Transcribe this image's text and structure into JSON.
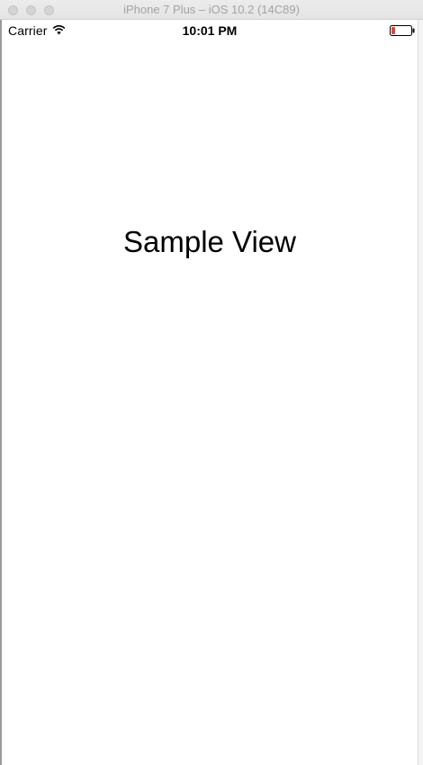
{
  "window": {
    "title": "iPhone 7 Plus – iOS 10.2 (14C89)"
  },
  "status_bar": {
    "carrier": "Carrier",
    "time": "10:01 PM",
    "wifi_icon": "wifi-icon",
    "battery_icon": "battery-low-icon",
    "battery_color": "#e0443e"
  },
  "main": {
    "label": "Sample View"
  }
}
